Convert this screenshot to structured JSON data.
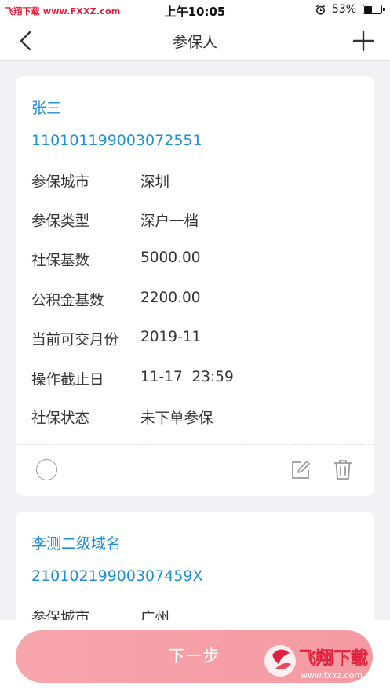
{
  "status_bar": {
    "watermark": "飞翔下载 www.FXXZ.com",
    "time": "上午10:05",
    "battery": "53%",
    "battery_level": 0.53
  },
  "nav": {
    "title": "参保人"
  },
  "cards": [
    {
      "name": "张三",
      "id_number": "110101199003072551",
      "rows": [
        {
          "label": "参保城市",
          "value": "深圳"
        },
        {
          "label": "参保类型",
          "value": "深户一档"
        },
        {
          "label": "社保基数",
          "value": "5000.00"
        },
        {
          "label": "公积金基数",
          "value": "2200.00"
        },
        {
          "label": "当前可交月份",
          "value": "2019-11"
        },
        {
          "label": "操作截止日",
          "value": "11-17  23:59"
        },
        {
          "label": "社保状态",
          "value": "未下单参保"
        }
      ]
    },
    {
      "name": "李测二级域名",
      "id_number": "21010219900307459X",
      "rows": [
        {
          "label": "参保城市",
          "value": "广州"
        }
      ]
    }
  ],
  "footer": {
    "next_label": "下一步"
  },
  "logo": {
    "text": "飞翔下载",
    "url": "www.fxxz.com"
  },
  "colors": {
    "accent_blue": "#1e90d6",
    "button_pink": "#f59aa3",
    "watermark_red": "#e0203a"
  }
}
